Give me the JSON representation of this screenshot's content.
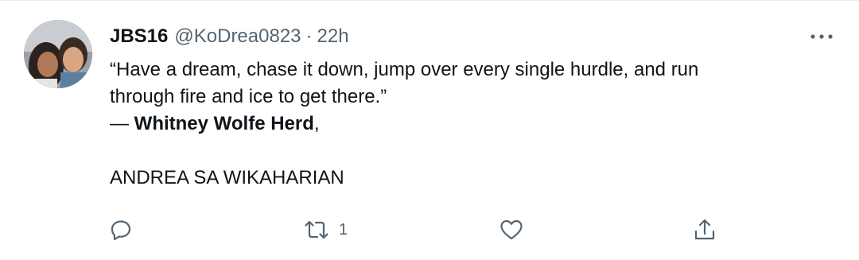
{
  "tweet": {
    "display_name": "JBS16",
    "handle": "@KoDrea0823",
    "separator": "·",
    "time": "22h",
    "quote_line_1": "“Have a dream, chase it down, jump over every single hurdle, and run",
    "quote_line_2": "through fire and ice to get there.”",
    "attribution_dash": "— ",
    "attribution_name": "Whitney Wolfe Herd",
    "attribution_suffix": ",",
    "closing_line": "ANDREA SA WIKAHARIAN",
    "retweet_count": "1"
  },
  "icons": {
    "more": "more-dots-icon",
    "reply": "reply-bubble-icon",
    "retweet": "retweet-icon",
    "like": "heart-icon",
    "share": "share-upload-icon"
  },
  "colors": {
    "text": "#0f1419",
    "secondary": "#536471",
    "border": "#e6ecf0"
  }
}
